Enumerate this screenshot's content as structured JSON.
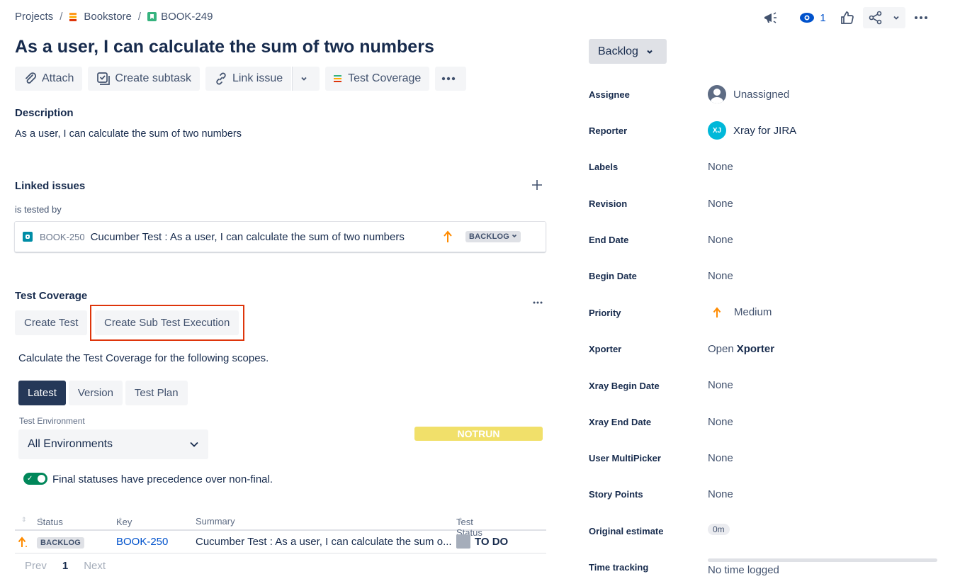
{
  "breadcrumb": {
    "projects": "Projects",
    "separator": "/",
    "project": "Bookstore",
    "issue_key": "BOOK-249"
  },
  "issue": {
    "title": "As a user, I can calculate the sum of two numbers"
  },
  "toolbar": {
    "attach": "Attach",
    "create_subtask": "Create subtask",
    "link_issue": "Link issue",
    "test_coverage": "Test Coverage"
  },
  "description": {
    "heading": "Description",
    "text": "As a user, I can calculate the sum of two numbers"
  },
  "linked_issues": {
    "heading": "Linked issues",
    "relation": "is tested by",
    "item": {
      "key": "BOOK-250",
      "summary": "Cucumber Test : As a user, I can calculate the sum of two numbers",
      "status": "BACKLOG"
    }
  },
  "test_coverage": {
    "heading": "Test Coverage",
    "create_test": "Create Test",
    "create_sub_test_execution": "Create Sub Test Execution",
    "intro": "Calculate the Test Coverage for the following scopes.",
    "tabs": [
      "Latest",
      "Version",
      "Test Plan"
    ],
    "env_label": "Test Environment",
    "env_value": "All Environments",
    "notrun_label": "NOTRUN",
    "toggle_label": "Final statuses have precedence over non-final.",
    "table": {
      "headers": [
        "Status",
        "Key",
        "Summary",
        "Test Status"
      ],
      "row": {
        "status": "BACKLOG",
        "key": "BOOK-250",
        "summary": "Cucumber Test : As a user, I can calculate the sum o...",
        "test_status": "TO DO"
      }
    },
    "pager": {
      "prev": "Prev",
      "page": "1",
      "next": "Next"
    }
  },
  "header_actions": {
    "watch_count": "1"
  },
  "sidebar": {
    "status": "Backlog",
    "fields": [
      {
        "label": "Assignee",
        "value": "Unassigned"
      },
      {
        "label": "Reporter",
        "value": "Xray for JIRA",
        "avatar": "XJ"
      },
      {
        "label": "Labels",
        "value": "None"
      },
      {
        "label": "Revision",
        "value": "None"
      },
      {
        "label": "End Date",
        "value": "None"
      },
      {
        "label": "Begin Date",
        "value": "None"
      },
      {
        "label": "Priority",
        "value": "Medium"
      },
      {
        "label": "Xporter",
        "value_prefix": "Open",
        "value": "Xporter"
      },
      {
        "label": "Xray Begin Date",
        "value": "None"
      },
      {
        "label": "Xray End Date",
        "value": "None"
      },
      {
        "label": "User MultiPicker",
        "value": "None"
      },
      {
        "label": "Story Points",
        "value": "None"
      },
      {
        "label": "Original estimate",
        "value": "0m"
      },
      {
        "label": "Time tracking",
        "value": "No time logged"
      }
    ]
  },
  "colors": {
    "primary_text": "#172b4d",
    "secondary_text": "#42526e",
    "priority_medium": "#ff8b00",
    "notrun": "#f1e06a",
    "highlight_box": "#de350b",
    "tab_active": "#253858",
    "toggle_on": "#00875a"
  }
}
